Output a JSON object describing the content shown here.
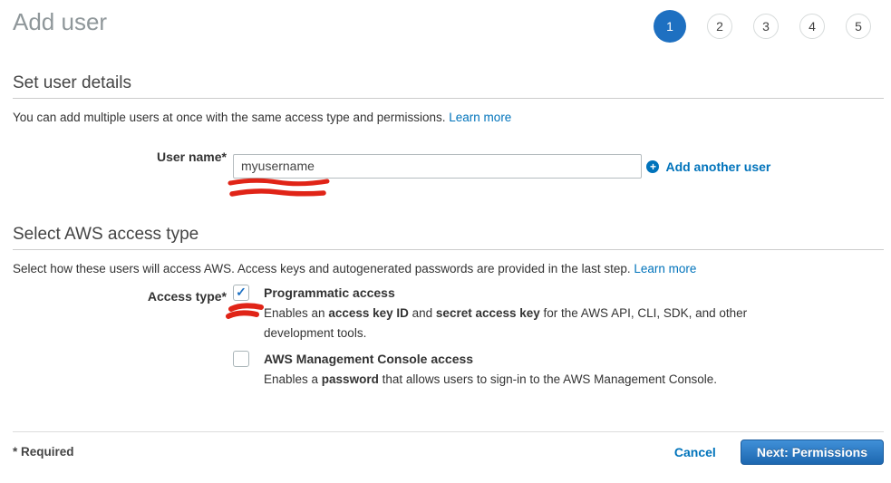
{
  "page": {
    "title": "Add user"
  },
  "steps": {
    "items": [
      "1",
      "2",
      "3",
      "4",
      "5"
    ],
    "active": "1"
  },
  "sections": {
    "user_details": {
      "heading": "Set user details",
      "intro": "You can add multiple users at once with the same access type and permissions.",
      "learn_more": "Learn more",
      "username_label": "User name*",
      "username_value": "myusername",
      "add_another": "Add another user"
    },
    "access_type": {
      "heading": "Select AWS access type",
      "intro": "Select how these users will access AWS. Access keys and autogenerated passwords are provided in the last step.",
      "learn_more": "Learn more",
      "label": "Access type*",
      "options": [
        {
          "label": "Programmatic access",
          "checked": true,
          "desc": [
            "Enables an ",
            "access key ID",
            " and ",
            "secret access key",
            " for the AWS API, CLI, SDK, and other development tools."
          ]
        },
        {
          "label": "AWS Management Console access",
          "checked": false,
          "desc": [
            "Enables a ",
            "password",
            " that allows users to sign-in to the AWS Management Console."
          ]
        }
      ]
    }
  },
  "footer": {
    "required_note": "* Required",
    "cancel_label": "Cancel",
    "next_label": "Next: Permissions"
  },
  "icons": {
    "plus_glyph": "+",
    "check_glyph": "✓"
  },
  "colors": {
    "accent_blue": "#0073bb",
    "step_active_blue": "#1e70c1",
    "button_blue_top": "#4090d8",
    "button_blue_bottom": "#1d67b0",
    "annotation_red": "#e02417",
    "title_gray": "#8f979a"
  }
}
